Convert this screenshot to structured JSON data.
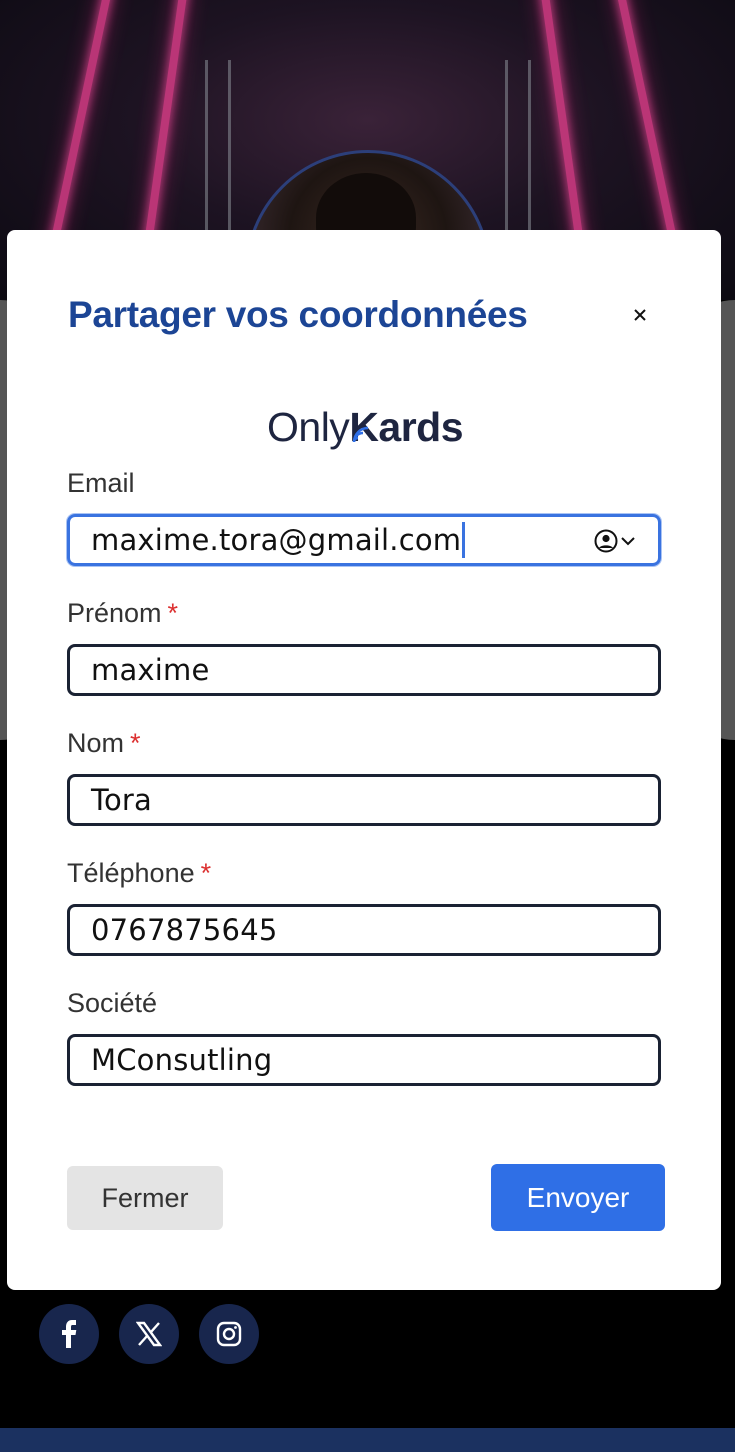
{
  "modal": {
    "title": "Partager vos coordonnées",
    "close_symbol": "×",
    "logo": {
      "part1": "Only",
      "part2": "Kards"
    }
  },
  "form": {
    "email": {
      "label": "Email",
      "value": "maxime.tora@gmail.com",
      "required": false,
      "focused": true
    },
    "firstname": {
      "label": "Prénom",
      "value": "maxime",
      "required": true
    },
    "lastname": {
      "label": "Nom",
      "value": "Tora",
      "required": true
    },
    "phone": {
      "label": "Téléphone",
      "value": "0767875645",
      "required": true
    },
    "company": {
      "label": "Société",
      "value": "MConsutling",
      "required": false
    },
    "required_mark": "*"
  },
  "actions": {
    "close_label": "Fermer",
    "send_label": "Envoyer"
  },
  "background": {
    "social_icons": [
      "facebook-icon",
      "x-icon",
      "instagram-icon"
    ]
  },
  "colors": {
    "title": "#1c4595",
    "primary_button": "#2f6fe6",
    "required": "#dc3030",
    "focus_border": "#3a73e0"
  }
}
